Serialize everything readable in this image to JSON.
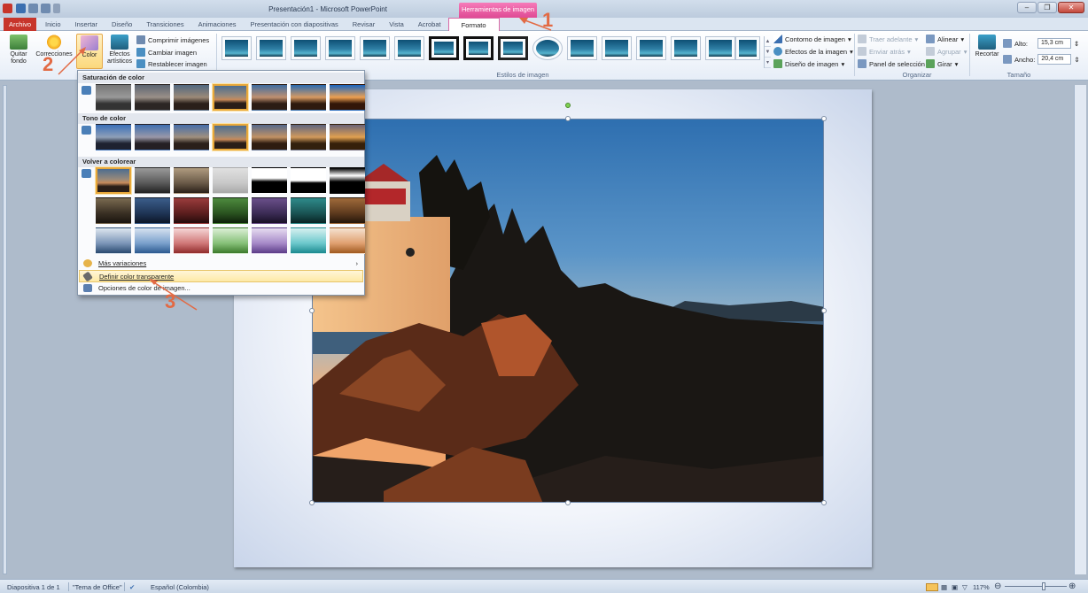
{
  "window": {
    "title": "Presentación1 - Microsoft PowerPoint",
    "context_tab_header": "Herramientas de imagen"
  },
  "tabs": [
    "Archivo",
    "Inicio",
    "Insertar",
    "Diseño",
    "Transiciones",
    "Animaciones",
    "Presentación con diapositivas",
    "Revisar",
    "Vista",
    "Acrobat",
    "Formato"
  ],
  "ribbon": {
    "ajustar": {
      "quitar_fondo": "Quitar fondo",
      "correcciones": "Correcciones",
      "color": "Color",
      "efectos_artisticos": "Efectos artísticos",
      "comprimir": "Comprimir imágenes",
      "cambiar": "Cambiar imagen",
      "restablecer": "Restablecer imagen"
    },
    "estilos": {
      "group_label": "Estilos de imagen",
      "contorno": "Contorno de imagen",
      "efectos": "Efectos de la imagen",
      "diseno": "Diseño de imagen"
    },
    "organizar": {
      "group_label": "Organizar",
      "traer_adelante": "Traer adelante",
      "enviar_atras": "Enviar atrás",
      "panel_seleccion": "Panel de selección",
      "alinear": "Alinear",
      "agrupar": "Agrupar",
      "girar": "Girar"
    },
    "tamano": {
      "group_label": "Tamaño",
      "recortar": "Recortar",
      "alto_label": "Alto:",
      "alto_value": "15,3 cm",
      "ancho_label": "Ancho:",
      "ancho_value": "20,4 cm"
    }
  },
  "dropdown": {
    "saturacion": "Saturación de color",
    "tono": "Tono de color",
    "volver": "Volver a colorear",
    "mas_variaciones": "Más variaciones",
    "definir_transparente": "Definir color transparente",
    "opciones": "Opciones de color de imagen..."
  },
  "annotations": [
    "1",
    "2",
    "3"
  ],
  "statusbar": {
    "slide": "Diapositiva 1 de 1",
    "theme": "\"Tema de Office\"",
    "language": "Español (Colombia)",
    "zoom": "117%"
  },
  "colors": {
    "accent_context": "#df4a94",
    "file_tab": "#c7352b",
    "annotation": "#e26a44",
    "selection": "#e8a83a"
  }
}
